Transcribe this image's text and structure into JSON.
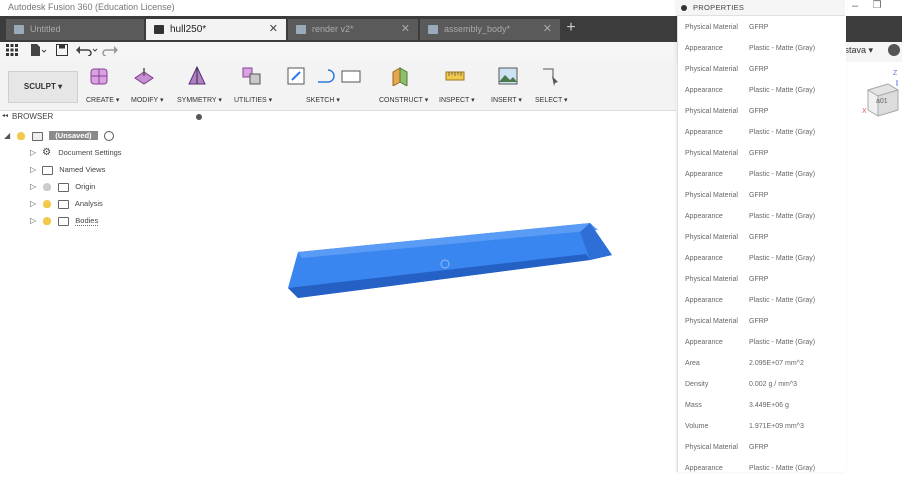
{
  "window": {
    "title": "Autodesk Fusion 360 (Education License)",
    "minimize_glyph": "–",
    "maximize_glyph": "❐"
  },
  "tabs": [
    {
      "label": "Untitled",
      "active": false
    },
    {
      "label": "hull250*",
      "active": true
    },
    {
      "label": "render v2*",
      "active": false
    },
    {
      "label": "assembly_body*",
      "active": false
    }
  ],
  "tab_close_glyph": "✕",
  "tab_add_glyph": "+",
  "quick_access": {
    "user": "rivastava ▾"
  },
  "ribbon": {
    "workspace": "SCULPT ▾",
    "groups": [
      "CREATE ▾",
      "MODIFY ▾",
      "SYMMETRY ▾",
      "UTILITIES ▾",
      "SKETCH ▾",
      "CONSTRUCT ▾",
      "INSPECT ▾",
      "INSERT ▾",
      "SELECT ▾"
    ]
  },
  "browser": {
    "title": "BROWSER",
    "collapse_glyph": "◂◂",
    "root": "(Unsaved)",
    "items": [
      "Document Settings",
      "Named Views",
      "Origin",
      "Analysis",
      "Bodies"
    ]
  },
  "viewcube": {
    "face_label": "a01",
    "axis_z": "Z",
    "axis_x": "X"
  },
  "properties": {
    "title": "PROPERTIES",
    "rows": [
      {
        "key": "Physical Material",
        "value": "GFRP"
      },
      {
        "key": "Appearance",
        "value": "Plastic - Matte (Gray)"
      },
      {
        "key": "Physical Material",
        "value": "GFRP"
      },
      {
        "key": "Appearance",
        "value": "Plastic - Matte (Gray)"
      },
      {
        "key": "Physical Material",
        "value": "GFRP"
      },
      {
        "key": "Appearance",
        "value": "Plastic - Matte (Gray)"
      },
      {
        "key": "Physical Material",
        "value": "GFRP"
      },
      {
        "key": "Appearance",
        "value": "Plastic - Matte (Gray)"
      },
      {
        "key": "Physical Material",
        "value": "GFRP"
      },
      {
        "key": "Appearance",
        "value": "Plastic - Matte (Gray)"
      },
      {
        "key": "Physical Material",
        "value": "GFRP"
      },
      {
        "key": "Appearance",
        "value": "Plastic - Matte (Gray)"
      },
      {
        "key": "Physical Material",
        "value": "GFRP"
      },
      {
        "key": "Appearance",
        "value": "Plastic - Matte (Gray)"
      },
      {
        "key": "Physical Material",
        "value": "GFRP"
      },
      {
        "key": "Appearance",
        "value": "Plastic - Matte (Gray)"
      },
      {
        "key": "Area",
        "value": "2.095E+07 mm^2"
      },
      {
        "key": "Density",
        "value": "0.002 g / mm^3"
      },
      {
        "key": "Mass",
        "value": "3.449E+06 g"
      },
      {
        "key": "Volume",
        "value": "1.971E+09 mm^3"
      },
      {
        "key": "Physical Material",
        "value": "GFRP"
      },
      {
        "key": "Appearance",
        "value": "Plastic - Matte (Gray)"
      }
    ]
  },
  "colors": {
    "tab_bar": "#3c3c3c",
    "body_blue": "#2f7ae5",
    "body_blue_dark": "#1f5fc0"
  }
}
